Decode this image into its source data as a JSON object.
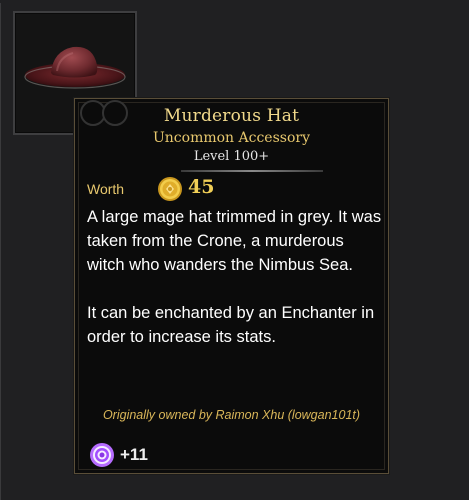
{
  "item": {
    "name": "Murderous Hat",
    "subtitle": "Uncommon Accessory",
    "level": "Level 100+"
  },
  "worth": {
    "label": "Worth",
    "value": "45",
    "coin_icon": "gold-coin-icon"
  },
  "description": {
    "paragraph_1": "A large mage hat trimmed in grey. It was taken from the Crone, a murderous witch who wanders the Nimbus Sea.",
    "paragraph_2": "It can be enchanted by an Enchanter in order to increase its stats."
  },
  "owner_note": "Originally owned by Raimon Xhu (lowgan101t)",
  "stat": {
    "icon": "enchant-ring-icon",
    "value": "+11"
  },
  "colors": {
    "title": "#f1d98b",
    "rarity": "#e8c86e",
    "coin": "#f1cf57",
    "stat_icon": "#b66cff"
  }
}
